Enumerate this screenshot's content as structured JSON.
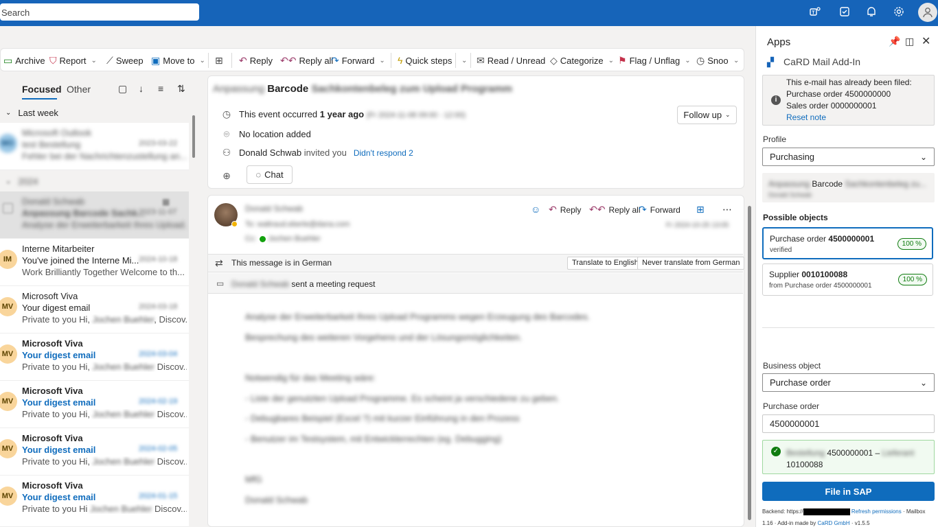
{
  "topbar": {
    "search_placeholder": "Search",
    "icons": [
      "teams-icon",
      "todo-icon",
      "bell-icon",
      "gear-icon",
      "account-icon"
    ]
  },
  "ribbon": {
    "archive": "Archive",
    "report": "Report",
    "sweep": "Sweep",
    "move_to": "Move to",
    "reply": "Reply",
    "reply_all": "Reply all",
    "forward": "Forward",
    "quick_steps": "Quick steps",
    "read_unread": "Read / Unread",
    "categorize": "Categorize",
    "flag_unflag": "Flag / Unflag",
    "snooze": "Snoo"
  },
  "list": {
    "tab_focused": "Focused",
    "tab_other": "Other",
    "group_last_week": "Last week",
    "group_2024": "2024",
    "items": [
      {
        "initials": "MO",
        "from": "Microsoft Outlook",
        "subject": "test Bestellung",
        "date": "2023-03-22",
        "preview": "Fehler bei der Nachrichtenzustellung an..."
      },
      {
        "initials": "",
        "from": "Donald Schwab",
        "subject": "Anpassung Barcode Sachk...",
        "date": "2023-11-07",
        "preview": "Analyse der Erweiterbarkeit Ihres Upload..."
      },
      {
        "initials": "IM",
        "from": "Interne Mitarbeiter",
        "subject": "You've joined the Interne Mi...",
        "date": "2024-10-18",
        "preview": "Work Brilliantly Together Welcome to th..."
      },
      {
        "initials": "MV",
        "from": "Microsoft Viva",
        "subject": "Your digest email",
        "date": "2024-03-18",
        "preview_a": "Private to you Hi,",
        "preview_name": "Jochen Buehler",
        "preview_b": ", Discov..."
      },
      {
        "initials": "MV",
        "from": "Microsoft Viva",
        "subject": "Your digest email",
        "date": "2024-03-04",
        "preview_a": "Private to you Hi,",
        "preview_name": "Jochen Buehler",
        "preview_b": "Discov..."
      },
      {
        "initials": "MV",
        "from": "Microsoft Viva",
        "subject": "Your digest email",
        "date": "2024-02-19",
        "preview_a": "Private to you Hi,",
        "preview_name": "Jochen Buehler",
        "preview_b": "Discov..."
      },
      {
        "initials": "MV",
        "from": "Microsoft Viva",
        "subject": "Your digest email",
        "date": "2024-02-05",
        "preview_a": "Private to you Hi,",
        "preview_name": "Jochen Buehler",
        "preview_b": "Discov..."
      },
      {
        "initials": "MV",
        "from": "Microsoft Viva",
        "subject": "Your digest email",
        "date": "2024-01-15",
        "preview_a": "Private to you Hi",
        "preview_name": "Jochen Buehler",
        "preview_b": "Discov..."
      }
    ]
  },
  "event": {
    "subject_pre": "Anpassung",
    "subject_mid": "Barcode",
    "subject_post": "Sachkontenbeleg zum Upload Programm",
    "occurred_pre": "This event occurred",
    "occurred_bold": "1 year ago",
    "occurred_time": "(Fr 2024-11-08 09:00 - 12:00)",
    "location": "No location added",
    "inviter": "Donald Schwab",
    "invited_you": "invited you",
    "didnt_respond": "Didn't respond 2",
    "follow_up": "Follow up",
    "chat": "Chat"
  },
  "message": {
    "sender": "Donald Schwab",
    "to_label": "To:",
    "to": "waltraud.eberle@dana.com",
    "cc_label": "Cc:",
    "cc": "Jochen Buehler",
    "date": "Fr 2024-10-25 13:05",
    "reply": "Reply",
    "reply_all": "Reply all",
    "forward": "Forward",
    "translate_text": "This message is in German",
    "translate_btn": "Translate to English",
    "never_translate": "Never translate from German",
    "meeting_sender": "Donald Schwab",
    "meeting_text": "sent a meeting request",
    "body": [
      "Analyse der Erweiterbarkeit Ihres Upload Programms wegen Erzeugung des Barcodes.",
      "Besprechung des weiteren Vorgehens und der Lösungsmöglichkeiten.",
      "Notwendig für das Meeting wäre:",
      "- Liste der genutzten Upload Programme. Es scheint ja verschiedene zu geben.",
      "- Debugbares Beispiel (Excel ?) mit kurzer Einführung in den Prozess",
      "- Benutzer im Testsystem, mit Entwicklerrechten (eg. Debugging)",
      "MfG",
      "Donald Schwab"
    ]
  },
  "apps": {
    "title": "Apps",
    "addin_name": "CaRD Mail Add-In",
    "notice_line1": "This e-mail has already been filed:",
    "notice_line2": "Purchase order 4500000000",
    "notice_line3": "Sales order 0000000001",
    "reset_note": "Reset note",
    "profile_label": "Profile",
    "profile_value": "Purchasing",
    "mail_subject_pre": "Anpassung",
    "mail_subject_mid": "Barcode",
    "mail_subject_post": "Sachkontenbeleg zu...",
    "mail_sender": "Donald Schwab",
    "possible_objects": "Possible objects",
    "obj1_type": "Purchase order",
    "obj1_num": "4500000001",
    "obj1_sub": "verified",
    "obj1_pct": "100 %",
    "obj2_type": "Supplier",
    "obj2_num": "0010100088",
    "obj2_sub": "from Purchase order 4500000001",
    "obj2_pct": "100 %",
    "business_object_label": "Business object",
    "business_object_value": "Purchase order",
    "po_label": "Purchase order",
    "po_value": "4500000001",
    "success_blur1": "Bestellung",
    "success_num": "4500000001 –",
    "success_blur2": "Lieferant",
    "success_line2": "10100088",
    "file_btn": "File in SAP",
    "footer_backend": "Backend: https://",
    "footer_refresh": "Refresh permissions",
    "footer_mailbox": "· Mailbox",
    "footer_line2_a": "1.16 · Add-in made by",
    "footer_card": "CaRD GmbH",
    "footer_version": "· v1.5.5"
  },
  "colors": {
    "brand": "#1664b9",
    "accent": "#0f6cbd",
    "success": "#107c10"
  }
}
